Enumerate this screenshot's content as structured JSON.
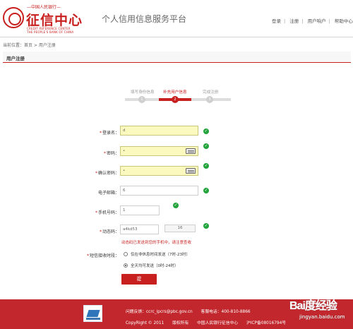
{
  "header": {
    "logo": {
      "top_text": "—中国人民银行—",
      "main_text": "征信中心",
      "sub_line1": "CREDIT REFERENCE CENTER",
      "sub_line2": "THE PEOPLE'S BANK OF CHINA"
    },
    "platform_title": "个人信用信息服务平台",
    "links": [
      "登录",
      "注册",
      "用户响户",
      "帮助中心"
    ]
  },
  "breadcrumb": "当前位置：首页 > 用户注册",
  "section_title": "用户注册",
  "steps": [
    {
      "label": "填写身份信息",
      "number": "1",
      "state": "done"
    },
    {
      "label": "补充用户信息",
      "number": "2",
      "state": "active"
    },
    {
      "label": "完成注册",
      "number": "3",
      "state": "pending"
    }
  ],
  "form": {
    "login_label": "登录名：",
    "login_value": "d",
    "password_label": "密码：",
    "password_value": "•",
    "confirm_label": "确认密码：",
    "confirm_value": "•",
    "email_label": "电子邮箱：",
    "email_value": "6",
    "phone_label": "手机号码：",
    "phone_value": "1",
    "code_label": "动态码：",
    "code_value": "a4kd53",
    "code_button": "16",
    "notice": "动态码已发送到您的手机中，请注意查收",
    "sms_label": "短信接收时段：",
    "sms_option1": "仅在非休息时间发送（7时-23时）",
    "sms_option2": "全天均可发送（0时-24时）",
    "submit_label": "提"
  },
  "footer": {
    "email_text": "问题反馈：ccrc_ipcrs@pbc.gov.cn",
    "phone_text": "客服电话：400-810-8866",
    "copyright": "CopyRight © 2011",
    "rights": "版权所有",
    "owner": "中国人民银行征信中心",
    "icp": "沪ICP备08016794号"
  },
  "watermark": {
    "text": "Bai度经验",
    "domain": "jingyan.baidu.com"
  },
  "colors": {
    "brand_red": "#c81f1f",
    "success_green": "#22a33b",
    "field_yellow": "#fbf9bd",
    "footer_red": "#c1272d"
  },
  "icons": [
    "emblem-icon",
    "check-icon",
    "keyboard-icon",
    "radio-icon",
    "security-badge-icon"
  ]
}
